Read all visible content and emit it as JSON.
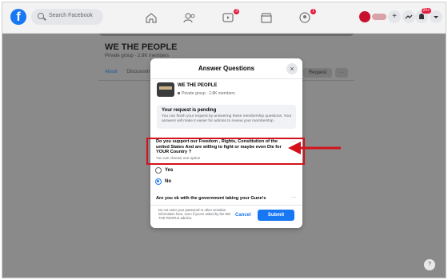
{
  "topbar": {
    "logo": "f",
    "search_placeholder": "Search Facebook",
    "nav_badge_1": "3",
    "nav_badge_2": "1",
    "notif_badge": "20+"
  },
  "background": {
    "group_title": "WE THE PEOPLE",
    "group_sub": "Private group · 2.8K members",
    "tabs": [
      "About",
      "Discussion"
    ],
    "btn_request": "Request",
    "btn_more": "···"
  },
  "modal": {
    "title": "Answer Questions",
    "close": "×",
    "group_name": "WE THE PEOPLE",
    "group_meta": "Private group · 2.8K members",
    "pending_title": "Your request is pending",
    "pending_desc": "You can finish your request by answering these membership questions. Your answers will make it easier for admins to review your membership.",
    "question1": "Do you support our Freedom , Rights, Constitution of the united States And are willing to fight or maybe even Die for YOUR Country ?",
    "question1_hint": "You can choose one option",
    "options": [
      {
        "label": "Yes",
        "selected": false
      },
      {
        "label": "No",
        "selected": true
      }
    ],
    "question2": "Are you ok with the government taking your Gunn's",
    "more_dots": "···",
    "note": "Do not enter your password or other sensitive information here, even if you're asked by the WE THE PEOPLE admins.",
    "cancel_label": "Cancel",
    "submit_label": "Submit"
  },
  "colors": {
    "accent": "#1877f2",
    "annotation": "#d4121c"
  },
  "help_icon": "?"
}
